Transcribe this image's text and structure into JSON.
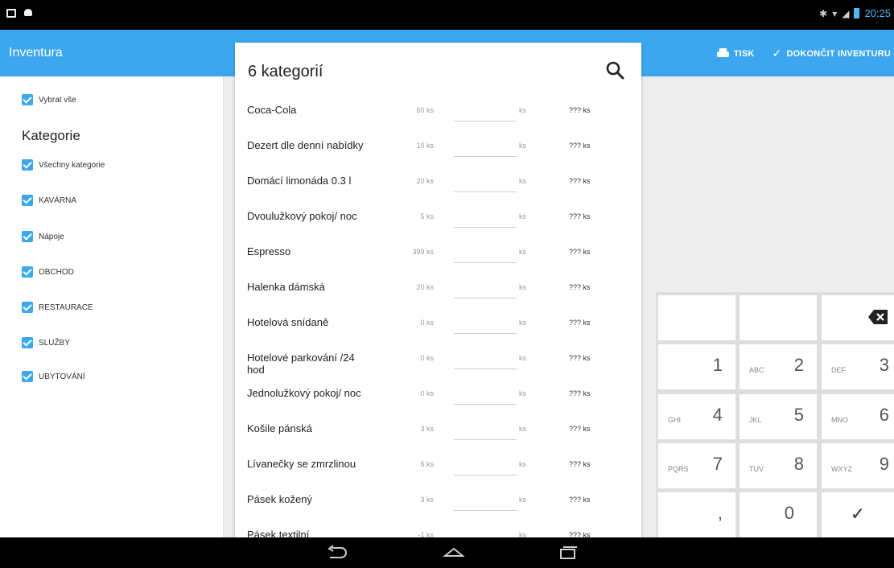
{
  "status_bar": {
    "time": "20:25"
  },
  "app_bar": {
    "title": "Inventura",
    "print_label": "TISK",
    "finish_label": "DOKONČIT INVENTURU"
  },
  "sidebar": {
    "select_all": "Vybrat vše",
    "heading": "Kategorie",
    "categories": [
      "Všechny kategorie",
      "KAVÁRNA",
      "Nápoje",
      "OBCHOD",
      "RESTAURACE",
      "SLUŽBY",
      "UBYTOVÁNÍ"
    ]
  },
  "card": {
    "title": "6 kategorií",
    "rows": [
      {
        "name": "Coca-Cola",
        "expected": "60 ks",
        "unit": "ks",
        "diff": "??? ks"
      },
      {
        "name": "Dezert dle denní nabídky",
        "expected": "10 ks",
        "unit": "ks",
        "diff": "??? ks"
      },
      {
        "name": "Domácí limonáda 0.3 l",
        "expected": "20 ks",
        "unit": "ks",
        "diff": "??? ks"
      },
      {
        "name": "Dvoulužkový pokoj/ noc",
        "expected": "5 ks",
        "unit": "ks",
        "diff": "??? ks"
      },
      {
        "name": "Espresso",
        "expected": "399 ks",
        "unit": "ks",
        "diff": "??? ks"
      },
      {
        "name": "Halenka dámská",
        "expected": "20 ks",
        "unit": "ks",
        "diff": "??? ks"
      },
      {
        "name": "Hotelová snídaně",
        "expected": "0 ks",
        "unit": "ks",
        "diff": "??? ks"
      },
      {
        "name": "Hotelové parkování /24 hod",
        "expected": "0 ks",
        "unit": "ks",
        "diff": "??? ks"
      },
      {
        "name": "Jednolužkový pokoj/ noc",
        "expected": "0 ks",
        "unit": "ks",
        "diff": "??? ks"
      },
      {
        "name": "Košile pánská",
        "expected": "3 ks",
        "unit": "ks",
        "diff": "??? ks"
      },
      {
        "name": "Lívanečky se zmrzlinou",
        "expected": "6 ks",
        "unit": "ks",
        "diff": "??? ks"
      },
      {
        "name": "Pásek kožený",
        "expected": "3 ks",
        "unit": "ks",
        "diff": "??? ks"
      },
      {
        "name": "Pásek textilní",
        "expected": "-1 ks",
        "unit": "ks",
        "diff": "??? ks"
      }
    ]
  },
  "keypad": {
    "keys": [
      {
        "num": "1",
        "letters": ""
      },
      {
        "num": "2",
        "letters": "ABC"
      },
      {
        "num": "3",
        "letters": "DEF"
      },
      {
        "num": "4",
        "letters": "GHI"
      },
      {
        "num": "5",
        "letters": "JKL"
      },
      {
        "num": "6",
        "letters": "MNO"
      },
      {
        "num": "7",
        "letters": "PQRS"
      },
      {
        "num": "8",
        "letters": "TUV"
      },
      {
        "num": "9",
        "letters": "WXYZ"
      }
    ],
    "comma": ",",
    "zero": "0",
    "confirm": "✓"
  },
  "colors": {
    "accent": "#3ca7ee",
    "status_accent": "#4fb8f3"
  },
  "icons": [
    "print-icon",
    "check-icon",
    "search-icon",
    "backspace-icon",
    "back-icon",
    "home-icon",
    "recents-icon"
  ]
}
